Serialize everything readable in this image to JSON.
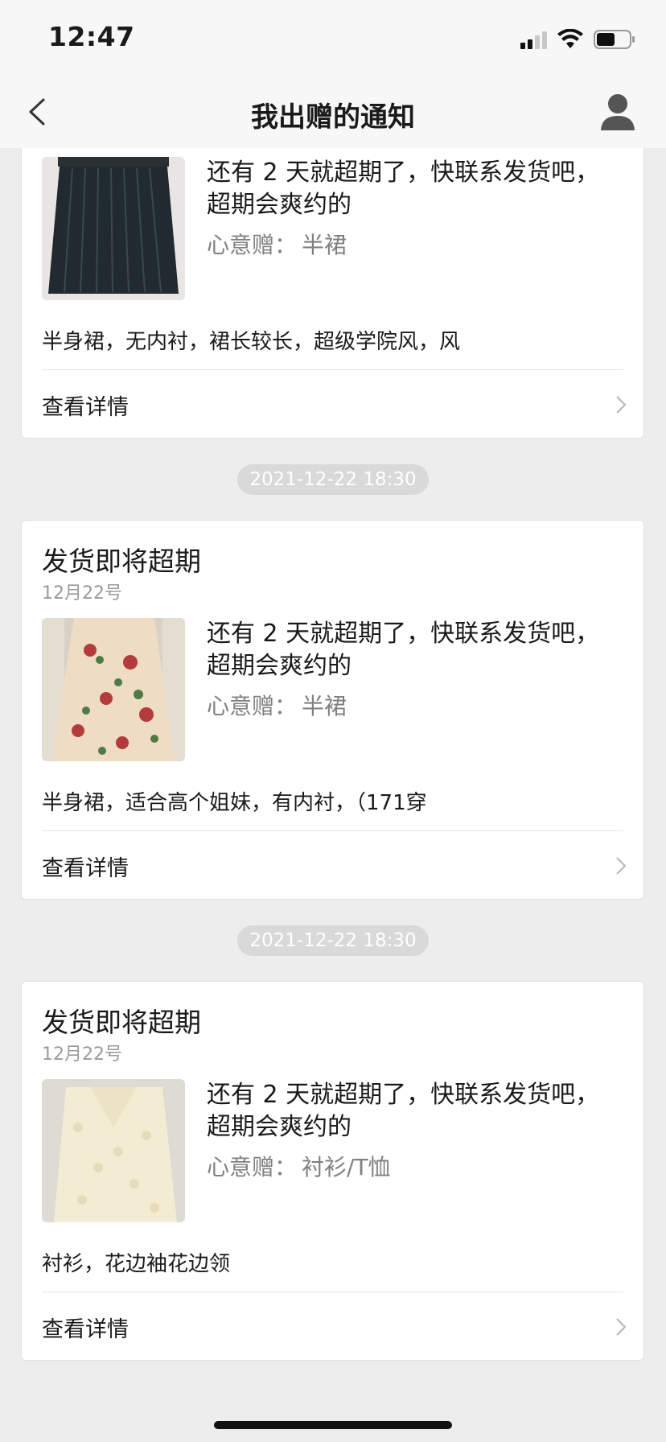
{
  "status_bar": {
    "time": "12:47",
    "icons": [
      "signal-icon",
      "wifi-icon",
      "battery-icon"
    ]
  },
  "nav": {
    "title": "我出赠的通知",
    "left_icon": "back-chevron-icon",
    "right_icon": "user-icon"
  },
  "cards": [
    {
      "title": "",
      "date": "",
      "message_line1": "还有 2 天就超期了，快联系发货吧，",
      "message_line2": "超期会爽约的",
      "gift_label": "心意赠：",
      "gift_item": "半裙",
      "thumb_desc": "dark pleated skirt",
      "description": "半身裙，无内衬，裙长较长，超级学院风，风",
      "detail_label": "查看详情"
    },
    {
      "title": "发货即将超期",
      "date": "12月22号",
      "message_line1": "还有 2 天就超期了，快联系发货吧，",
      "message_line2": "超期会爽约的",
      "gift_label": "心意赠：",
      "gift_item": "半裙",
      "thumb_desc": "floral midi skirt",
      "description": "半身裙，适合高个姐妹，有内衬，（171穿",
      "detail_label": "查看详情"
    },
    {
      "title": "发货即将超期",
      "date": "12月22号",
      "message_line1": "还有 2 天就超期了，快联系发货吧，",
      "message_line2": "超期会爽约的",
      "gift_label": "心意赠：",
      "gift_item": "衬衫/T恤",
      "thumb_desc": "cream lace blouse",
      "description": "衬衫，花边袖花边领",
      "detail_label": "查看详情"
    }
  ],
  "timestamps": [
    "2021-12-22 18:30",
    "2021-12-22 18:30"
  ],
  "colors": {
    "page_bg": "#ededed",
    "card_bg": "#ffffff",
    "muted_text": "#9a9a9a",
    "pill_bg": "#d9d9d9"
  }
}
